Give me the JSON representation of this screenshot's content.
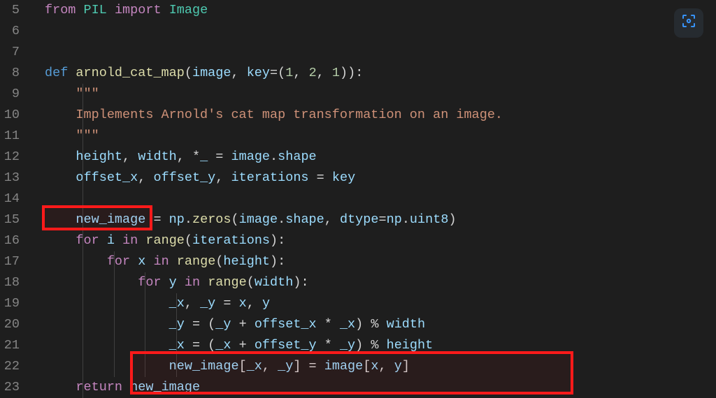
{
  "line_numbers": [
    "5",
    "6",
    "7",
    "8",
    "9",
    "10",
    "11",
    "12",
    "13",
    "14",
    "15",
    "16",
    "17",
    "18",
    "19",
    "20",
    "21",
    "22",
    "23"
  ],
  "code": {
    "l5": {
      "from": "from",
      "pil": "PIL",
      "import": "import",
      "image": "Image"
    },
    "l8": {
      "def": "def",
      "fn": "arnold_cat_map",
      "lp": "(",
      "p1": "image",
      "c1": ", ",
      "p2": "key",
      "eq": "=(",
      "n1": "1",
      "c2": ", ",
      "n2": "2",
      "c3": ", ",
      "n3": "1",
      "rp": ")):"
    },
    "l9": {
      "q": "\"\"\""
    },
    "l10": {
      "s": "Implements Arnold's cat map transformation on an image."
    },
    "l11": {
      "q": "\"\"\""
    },
    "l12": {
      "h": "height",
      "c1": ", ",
      "w": "width",
      "c2": ", *",
      "u": "_",
      "eq": " = ",
      "img": "image",
      ".": ".",
      "sh": "shape"
    },
    "l13": {
      "ox": "offset_x",
      "c1": ", ",
      "oy": "offset_y",
      "c2": ", ",
      "it": "iterations",
      "eq": " = ",
      "k": "key"
    },
    "l15": {
      "ni": "new_image",
      "eq": " = ",
      "np": "np",
      ".": ".",
      "z": "zeros",
      "lp": "(",
      "img": "image",
      ".2": ".",
      "sh": "shape",
      "c1": ", ",
      "dt": "dtype",
      "eq2": "=",
      "np2": "np",
      ".3": ".",
      "u8": "uint8",
      "rp": ")"
    },
    "l16": {
      "for": "for",
      "i": "i",
      "in": "in",
      "range": "range",
      "lp": "(",
      "it": "iterations",
      "rp": "):"
    },
    "l17": {
      "for": "for",
      "x": "x",
      "in": "in",
      "range": "range",
      "lp": "(",
      "h": "height",
      "rp": "):"
    },
    "l18": {
      "for": "for",
      "y": "y",
      "in": "in",
      "range": "range",
      "lp": "(",
      "w": "width",
      "rp": "):"
    },
    "l19": {
      "ux": "_x",
      "c1": ", ",
      "uy": "_y",
      "eq": " = ",
      "x": "x",
      "c2": ", ",
      "y": "y"
    },
    "l20": {
      "uy": "_y",
      "eq": " = (",
      "uy2": "_y",
      "p": " + ",
      "ox": "offset_x",
      "m": " * ",
      "ux": "_x",
      "rp": ") % ",
      "w": "width"
    },
    "l21": {
      "ux": "_x",
      "eq": " = (",
      "ux2": "_x",
      "p": " + ",
      "oy": "offset_y",
      "m": " * ",
      "uy": "_y",
      "rp": ") % ",
      "h": "height"
    },
    "l22": {
      "ni": "new_image",
      "lb": "[",
      "ux": "_x",
      "c1": ", ",
      "uy": "_y",
      "rb": "] = ",
      "img": "image",
      "lb2": "[",
      "x": "x",
      "c2": ", ",
      "y": "y",
      "rb2": "]"
    },
    "l23": {
      "ret": "return",
      "ni": "new_image"
    }
  },
  "icons": {
    "screenshot": "screenshot-icon"
  }
}
